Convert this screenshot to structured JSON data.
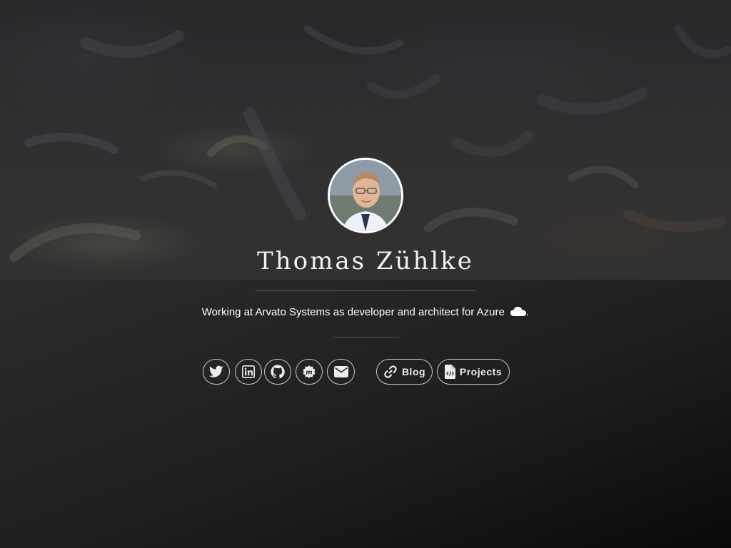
{
  "profile": {
    "name": "Thomas Zühlke",
    "tagline": "Working at Arvato Systems as developer and architect for Azure",
    "tagline_suffix": "."
  },
  "social": [
    {
      "icon": "twitter-icon"
    },
    {
      "icon": "linkedin-icon"
    },
    {
      "icon": "github-icon"
    },
    {
      "icon": "meetup-icon"
    },
    {
      "icon": "email-icon"
    }
  ],
  "links": {
    "blog_label": "Blog",
    "projects_label": "Projects"
  },
  "colors": {
    "text": "#ffffff",
    "border": "#d9d9d9"
  }
}
